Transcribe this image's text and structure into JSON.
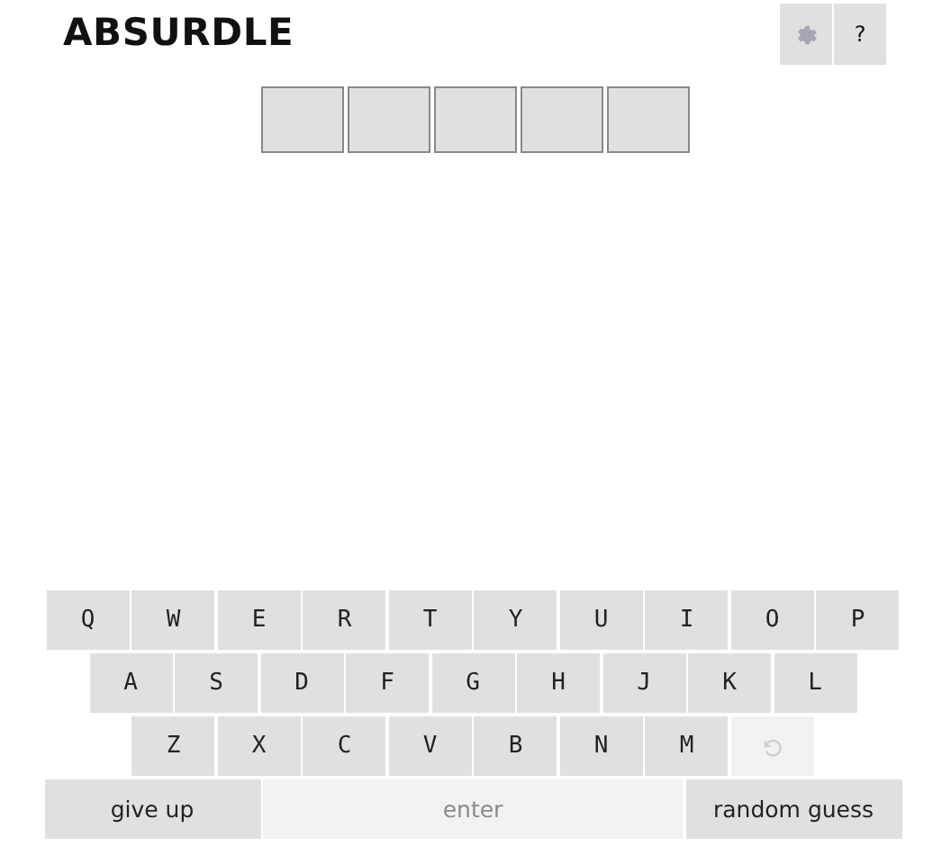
{
  "title": "ABSURDLE",
  "header_buttons": [
    {
      "kind": "settings",
      "disabled": true
    },
    {
      "kind": "text",
      "label": "?"
    }
  ],
  "tiles": [
    {
      "filled": false
    },
    {
      "filled": false
    },
    {
      "filled": false
    },
    {
      "filled": false
    },
    {
      "filled": false
    }
  ],
  "keyboard": [
    [
      {
        "kind": "letter",
        "label": "Q"
      },
      {
        "kind": "letter",
        "label": "W"
      },
      {
        "kind": "letter",
        "label": "E"
      },
      {
        "kind": "letter",
        "label": "R"
      },
      {
        "kind": "letter",
        "label": "T"
      },
      {
        "kind": "letter",
        "label": "Y"
      },
      {
        "kind": "letter",
        "label": "U"
      },
      {
        "kind": "letter",
        "label": "I"
      },
      {
        "kind": "letter",
        "label": "O"
      },
      {
        "kind": "letter",
        "label": "P"
      }
    ],
    [
      {
        "kind": "letter",
        "label": "A"
      },
      {
        "kind": "letter",
        "label": "S"
      },
      {
        "kind": "letter",
        "label": "D"
      },
      {
        "kind": "letter",
        "label": "F"
      },
      {
        "kind": "letter",
        "label": "G"
      },
      {
        "kind": "letter",
        "label": "H"
      },
      {
        "kind": "letter",
        "label": "J"
      },
      {
        "kind": "letter",
        "label": "K"
      },
      {
        "kind": "letter",
        "label": "L"
      }
    ],
    [
      {
        "kind": "letter",
        "label": "Z"
      },
      {
        "kind": "letter",
        "label": "X"
      },
      {
        "kind": "letter",
        "label": "C"
      },
      {
        "kind": "letter",
        "label": "V"
      },
      {
        "kind": "letter",
        "label": "B"
      },
      {
        "kind": "letter",
        "label": "N"
      },
      {
        "kind": "letter",
        "label": "M"
      },
      {
        "kind": "undo",
        "disabled": true
      }
    ]
  ],
  "actions": [
    {
      "label": "give up",
      "disabled": false
    },
    {
      "label": "enter",
      "disabled": true
    },
    {
      "label": "random guess",
      "disabled": false
    }
  ]
}
